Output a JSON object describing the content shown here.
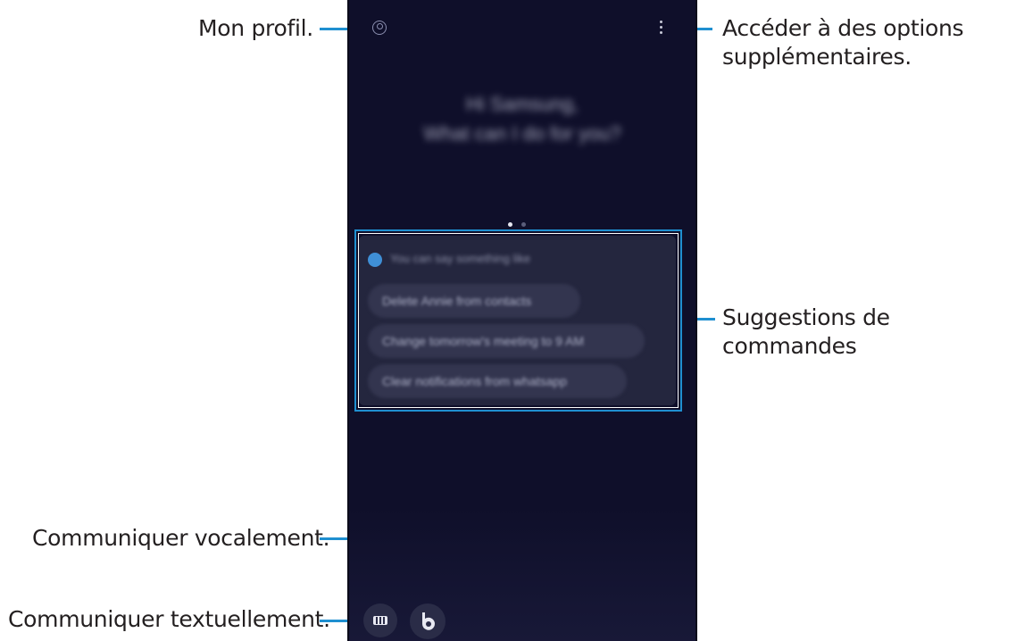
{
  "callouts": {
    "profile": "Mon profil.",
    "options_line1": "Accéder à des options",
    "options_line2": "supplémentaires.",
    "suggestions": "Suggestions de commandes",
    "voice": "Communiquer vocalement.",
    "text": "Communiquer textuellement."
  },
  "screen": {
    "greeting_line1": "Hi Samsung,",
    "greeting_line2": "What can I do for you?",
    "card_header": "You can say something like",
    "suggestions": [
      "Delete Annie from contacts",
      "Change tomorrow's meeting to 9 AM",
      "Clear notifications from whatsapp"
    ]
  },
  "colors": {
    "accent_line": "#1f8fd0",
    "phone_bg": "#0f0f2a",
    "card_bg": "#24263e"
  },
  "icons": {
    "profile": "profile-icon",
    "more": "more-options-icon",
    "keyboard": "keyboard-icon",
    "bixby": "bixby-voice-icon"
  }
}
